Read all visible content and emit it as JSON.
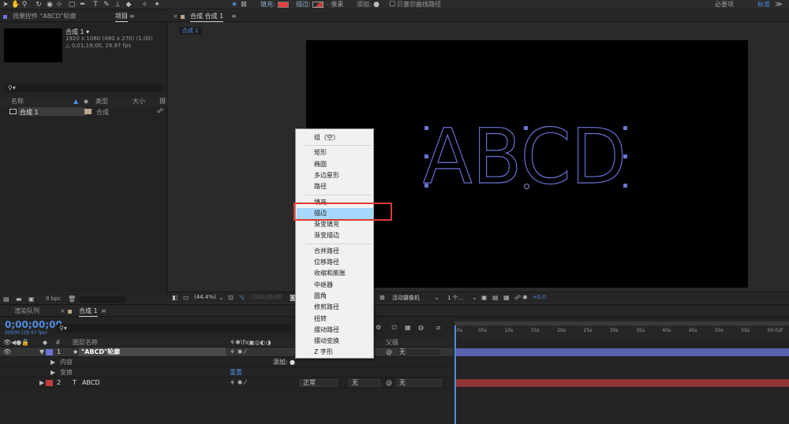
{
  "toolbar": {
    "fill_label": "填充:",
    "stroke_label": "描边:",
    "px_label": "- 像素",
    "add_label": "添加:",
    "bezier_label": "贝塞尔曲线路径",
    "workspace_essentials": "必要项",
    "workspace_standard": "标准",
    "fill_color": "#e04040",
    "stroke_color": "#c04040"
  },
  "project_panel": {
    "tab_effects": "效果控件 \"ABCD\"轮廓",
    "tab_project": "项目",
    "comp_name": "合成 1 ▾",
    "comp_res": "1920 x 1080 (480 x 270) (1.00)",
    "comp_info": "△ 0;01;19;00, 29.97 fps",
    "search_icon": "⚲▾",
    "col_name": "名称",
    "col_type": "类型",
    "col_size": "大小",
    "col_fr": "摄",
    "item_name": "合成 1",
    "item_type": "合成",
    "bpc": "8 bpc"
  },
  "viewer": {
    "close_mark": "×",
    "tab_label": "合成 合成 1",
    "subtab_label": "合成 1",
    "canvas_text": "ABCD",
    "zoom": "(44.4%)",
    "timecode": "0;00;00;00",
    "camera": "活动摄像机",
    "views": "1 个...",
    "exposure": "+0.0"
  },
  "timeline": {
    "tab_render": "渲染队列",
    "tab_comp": "合成 1",
    "timecode": "0;00;00;00",
    "timecode_sub": "00000 (29.97 fps)",
    "col_num": "#",
    "col_layer_name": "图层名称",
    "col_parent": "父级",
    "ruler_ticks": [
      "0s",
      "05s",
      "10s",
      "15s",
      "20s",
      "25s",
      "30s",
      "35s",
      "40s",
      "45s",
      "50s",
      "55s",
      "00:02f"
    ],
    "layers": [
      {
        "num": "1",
        "icon": "★",
        "name": "\"ABCD\"轮廓",
        "parent": "无",
        "color": "#6b73d6",
        "bar_color": "#5a5fae"
      },
      {
        "num": "2",
        "icon": "T",
        "name": "ABCD",
        "mode": "正常",
        "trkmat": "无",
        "parent": "无",
        "color": "#c23c3c",
        "bar_color": "#8f3535"
      }
    ],
    "sub_contents": "内容",
    "sub_add": "添加:",
    "sub_transform": "变换",
    "sub_reset": "重置"
  },
  "context_menu": {
    "items": [
      {
        "label": "组（空）"
      },
      {
        "label": "矩形"
      },
      {
        "label": "椭圆"
      },
      {
        "label": "多边星形"
      },
      {
        "label": "路径"
      },
      {
        "label": "填充"
      },
      {
        "label": "描边",
        "highlighted": true
      },
      {
        "label": "渐变填充"
      },
      {
        "label": "渐变描边"
      },
      {
        "label": "合并路径"
      },
      {
        "label": "位移路径"
      },
      {
        "label": "收缩和膨胀"
      },
      {
        "label": "中继器"
      },
      {
        "label": "圆角"
      },
      {
        "label": "修剪路径"
      },
      {
        "label": "扭转"
      },
      {
        "label": "摆动路径"
      },
      {
        "label": "摆动变换"
      },
      {
        "label": "Z 字形"
      }
    ]
  }
}
